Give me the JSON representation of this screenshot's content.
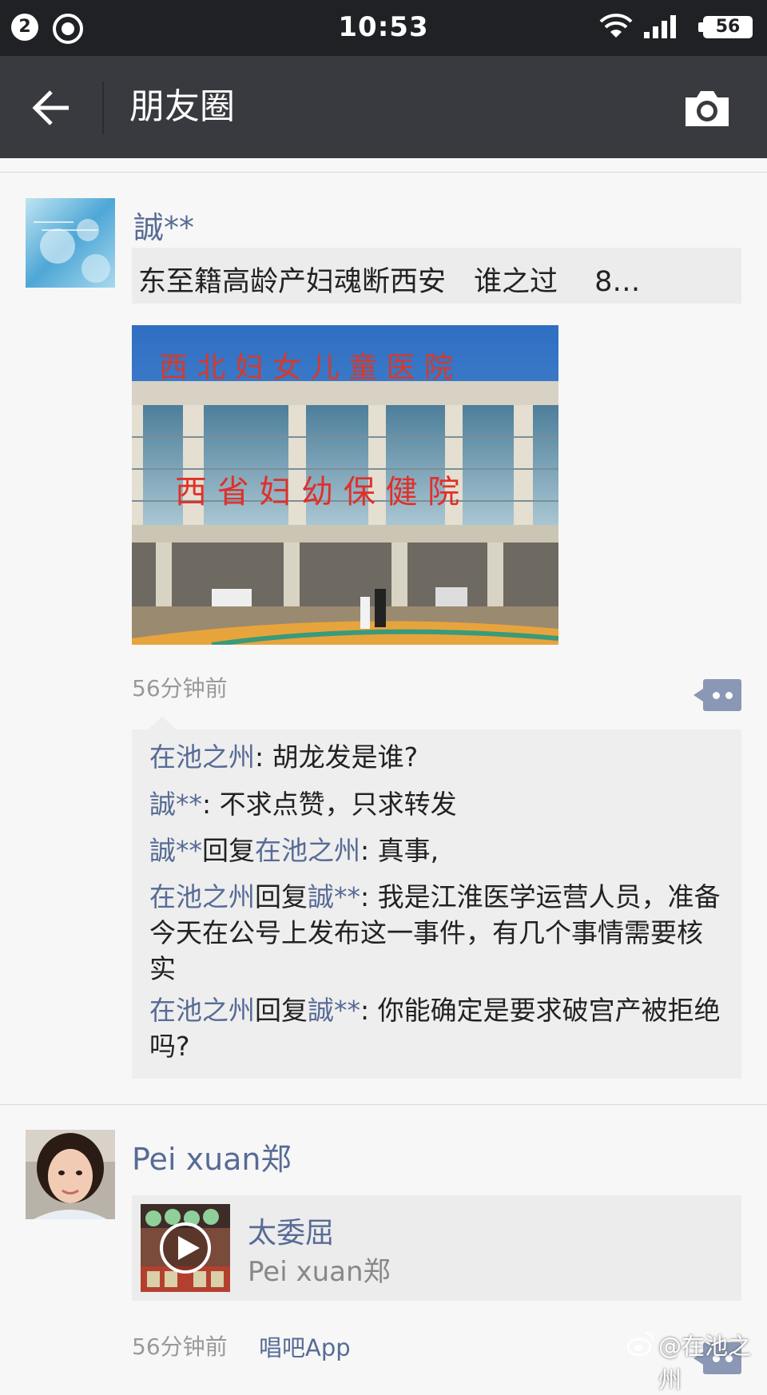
{
  "status_bar": {
    "notification_count": "2",
    "time": "10:53",
    "battery": "56"
  },
  "nav": {
    "title": "朋友圈"
  },
  "post1": {
    "author": "誠**",
    "share_title": "东至籍高龄产妇魂断西安　谁之过　 8…",
    "time": "56分钟前",
    "comments": [
      {
        "from": "在池之州",
        "sep": ": ",
        "text": "胡龙发是谁?"
      },
      {
        "from": "誠**",
        "sep": ": ",
        "text": "不求点赞，只求转发"
      },
      {
        "from": "誠**",
        "reply_word": "回复",
        "to": "在池之州",
        "sep": ": ",
        "text": "真事,"
      },
      {
        "from": "在池之州",
        "reply_word": "回复",
        "to": "誠**",
        "sep": ": ",
        "text": "我是江淮医学运营人员，准备今天在公号上发布这一事件，有几个事情需要核实"
      },
      {
        "from": "在池之州",
        "reply_word": "回复",
        "to": "誠**",
        "sep": ": ",
        "text": "你能确定是要求破宫产被拒绝吗?"
      }
    ]
  },
  "post2": {
    "author": "Pei xuan郑",
    "share_title": "太委屈",
    "share_subtitle": "Pei xuan郑",
    "time": "56分钟前",
    "app": "唱吧App"
  },
  "watermark": "@在池之州",
  "colors": {
    "link_blue": "#576b95",
    "navbar": "#393a3f",
    "statusbar": "#1f2124"
  }
}
